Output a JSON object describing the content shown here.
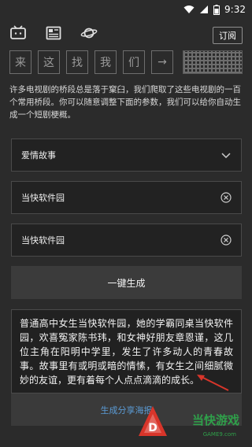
{
  "status": {
    "time": "9:32"
  },
  "toolbar": {
    "subscribe_label": "订阅"
  },
  "banner": {
    "chars": [
      "来",
      "这",
      "找",
      "我",
      "们",
      "→"
    ]
  },
  "description": "许多电视剧的桥段总是落于窠臼，我们爬取了这些电视剧的一百个常用桥段。你可以随意调整下面的参数，我们可以给你自动生成一个短剧梗概。",
  "form": {
    "genre_value": "爱情故事",
    "name1_value": "当快软件园",
    "name2_value": "当快软件园"
  },
  "generate_label": "一键生成",
  "story": "普通高中女生当快软件园，她的学霸同桌当快软件园，欢喜冤家陈书玮，和女神好朋友章恩谨，这几位主角在阳明中学里，发生了许多动人的青春故事。故事里有或明或暗的情愫，有女生之间细腻微妙的友谊，更有着每个人点点滴滴的成长。",
  "share_label": "生成分享海报",
  "watermark": {
    "logo_letter": "D",
    "title": "当快游戏",
    "subtitle": "GAME9.com"
  },
  "colors": {
    "background": "#2b2b2b",
    "accent_blue": "#5b9bd5",
    "watermark_green": "#2fa04a",
    "watermark_red": "#d8352a"
  }
}
